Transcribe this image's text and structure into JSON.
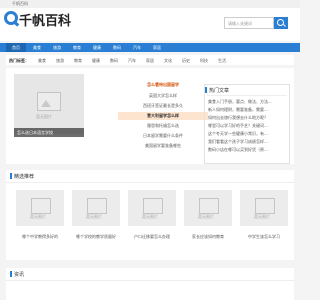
{
  "topbar": {
    "text": "千帆百科"
  },
  "header": {
    "logo_text": "千帆百科",
    "search_placeholder": "请输入关键词"
  },
  "nav": {
    "items": [
      "首页",
      "美食",
      "旅游",
      "教育",
      "健康",
      "数码",
      "汽车",
      "家居"
    ]
  },
  "hot_tags": {
    "label": "热门标签：",
    "tags": [
      "美食",
      "旅游",
      "教育",
      "健康",
      "数码",
      "汽车",
      "家居",
      "文化",
      "历史",
      "科技",
      "生活"
    ]
  },
  "featured": {
    "image_text": "暂无图片",
    "caption": "怎么选日本语言学校"
  },
  "middle_list": {
    "items": [
      {
        "text": "怎么看待出国留学",
        "style": "hl"
      },
      {
        "text": "英国大学怎么样",
        "style": "normal"
      },
      {
        "text": "西班牙签证最长是多久",
        "style": "normal"
      },
      {
        "text": "意大利留学怎么样",
        "style": "box"
      },
      {
        "text": "雅思和托福怎么选",
        "style": "normal"
      },
      {
        "text": "日本留学需要什么条件",
        "style": "normal"
      },
      {
        "text": "美国留学要准备哪些",
        "style": "normal"
      }
    ]
  },
  "hot_articles": {
    "title": "热门文章",
    "items": [
      "美食入门手册，要点、做法、方法...",
      "新人如何理财，需要准备，需要...",
      "如何出去旅行我想去什么地方呢？",
      "哪里可以学习好的手艺？关键词...",
      "这个冬天学一些健康小常识，有...",
      "我们看看这个孩子学习成绩怎样...",
      "数码小店在哪可以买到好货（原..."
    ]
  },
  "recommend": {
    "title": "精选推荐",
    "cards": [
      {
        "image_text": "暂无图片",
        "caption": "哪个中学教得多好的"
      },
      {
        "image_text": "暂无图片",
        "caption": "哪个学校的教学质量好"
      },
      {
        "image_text": "暂无图片",
        "caption": "户口迁移要怎么办理"
      },
      {
        "image_text": "暂无图片",
        "caption": "家长应该如何教育"
      },
      {
        "image_text": "暂无图片",
        "caption": "中学生该怎么学习"
      }
    ]
  },
  "bottom": {
    "title": "资讯"
  }
}
